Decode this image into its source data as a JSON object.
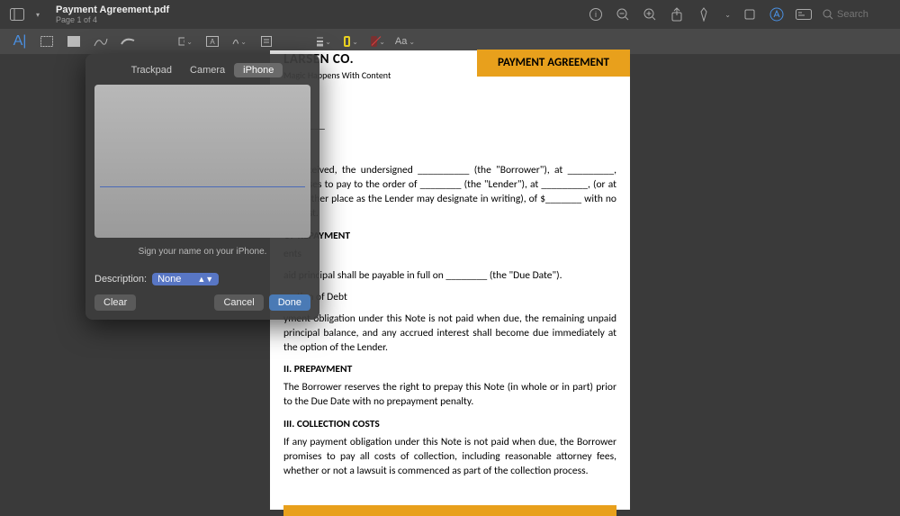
{
  "header": {
    "title": "Payment Agreement.pdf",
    "subtitle": "Page 1 of 4",
    "search_placeholder": "Search"
  },
  "popover": {
    "tabs": {
      "trackpad": "Trackpad",
      "camera": "Camera",
      "iphone": "iPhone"
    },
    "hint": "Sign your name on your iPhone.",
    "desc_label": "Description:",
    "desc_value": "None",
    "clear": "Clear",
    "cancel": "Cancel",
    "done": "Done"
  },
  "annotate": {
    "text_style": "Aa"
  },
  "doc": {
    "company": "LARSEN CO.",
    "tagline": "Magic Happens With Content",
    "badge": "PAYMENT AGREEMENT",
    "para_intro": "ue received, the undersigned __________ (the \"Borrower\"), at _________, promises to pay to the order of ________ (the \"Lender\"), at _________, (or at such other place as the Lender may designate in writing), of $_______ with no interest.",
    "sec1_title": "OF REPAYMENT",
    "sec1_a1": "ents",
    "sec1_a2": "aid principal shall be payable in full on ________ (the \"Due Date\").",
    "sec1_b_title": "eration of Debt",
    "sec1_b_body": "yment obligation under this Note is not paid when due, the remaining unpaid principal balance, and any accrued interest shall become due immediately at the option of the Lender.",
    "sec2_title": "II. PREPAYMENT",
    "sec2_body": "The Borrower reserves the right to prepay this Note (in whole or in part) prior to the Due Date with no prepayment penalty.",
    "sec3_title": "III. COLLECTION COSTS",
    "sec3_body": "If any payment obligation under this Note is not paid when due, the Borrower promises to pay all costs of collection, including reasonable attorney fees, whether or not a lawsuit is commenced as part of the collection process."
  }
}
